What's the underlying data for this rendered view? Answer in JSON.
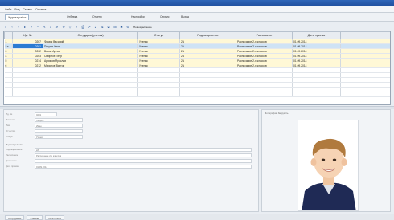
{
  "menu": {
    "items": [
      "Файл",
      "Вид",
      "Сервис",
      "Справка"
    ]
  },
  "subtabs": [
    "Журнал работ",
    "Отбивка",
    "Отчеты",
    "Настройки",
    "Сервис",
    "Выход"
  ],
  "toolbar": {
    "icons": [
      "first-icon",
      "prev-icon",
      "next-icon",
      "last-icon",
      "add-icon",
      "delete-icon",
      "edit-icon",
      "save-icon",
      "cancel-icon",
      "refresh-icon",
      "filter-icon",
      "search-icon",
      "print-icon",
      "export-icon",
      "import-icon",
      "sort-icon",
      "copy-icon",
      "paste-icon",
      "find-icon",
      "settings-icon"
    ],
    "glyphs": [
      "◂",
      "‹",
      "›",
      "▸",
      "+",
      "−",
      "✎",
      "✓",
      "✗",
      "↻",
      "▽",
      "⌕",
      "⎙",
      "↗",
      "↙",
      "⇅",
      "⧉",
      "⊞",
      "✱",
      "⚙"
    ],
    "label": "По возрастанию"
  },
  "grid": {
    "columns": [
      "",
      "Ид. №",
      "Сотрудник (ученик)",
      "Статус",
      "Подразделение",
      "Расписание",
      "Дата приема"
    ],
    "rows": [
      {
        "rn": "1",
        "id": "0207",
        "name": "Фамия Василий",
        "status": "Ученик",
        "dept": "2А",
        "schedule": "Расписание 2-х классов",
        "date": "01.09.2014",
        "selected": false
      },
      {
        "rn": "2 ▸",
        "id": "0201",
        "name": "Петров Иван",
        "status": "Ученик",
        "dept": "2А",
        "schedule": "Расписание 2-х классов",
        "date": "01.09.2014",
        "selected": true
      },
      {
        "rn": "3",
        "id": "0202",
        "name": "Васин Артем",
        "status": "Ученик",
        "dept": "2А",
        "schedule": "Расписание 2-х классов",
        "date": "01.09.2014",
        "selected": false
      },
      {
        "rn": "4",
        "id": "0203",
        "name": "Смирнов Петр",
        "status": "Ученик",
        "dept": "2А",
        "schedule": "Расписание 2-х классов",
        "date": "01.09.2014",
        "selected": false
      },
      {
        "rn": "5",
        "id": "0214",
        "name": "Архипов Ярослав",
        "status": "Ученик",
        "dept": "2А",
        "schedule": "Расписание 2-х классов",
        "date": "01.09.2014",
        "selected": false
      },
      {
        "rn": "6",
        "id": "0212",
        "name": "Миронов Виктор",
        "status": "Ученик",
        "dept": "2А",
        "schedule": "Расписание 2-х классов",
        "date": "01.09.2014",
        "selected": false
      }
    ]
  },
  "form": {
    "fields": [
      {
        "label": "Ид. №",
        "value": "0201"
      },
      {
        "label": "Фамилия",
        "value": "Петров"
      },
      {
        "label": "Имя",
        "value": "Иван"
      },
      {
        "label": "Отчество",
        "value": ""
      },
      {
        "label": "Статус",
        "value": "Ученик"
      }
    ],
    "section_title": "Подразделение",
    "fields2": [
      {
        "label": "Подразделение",
        "value": "2А"
      },
      {
        "label": "Расписание",
        "value": "Расписание 2-х классов"
      },
      {
        "label": "Должность",
        "value": ""
      },
      {
        "label": "Дата приема",
        "value": "01.09.2014"
      }
    ]
  },
  "photo": {
    "header": "Фотография   Загрузить"
  },
  "statusbar": {
    "tabs": [
      "Сотрудники",
      "Ученики",
      "Посетители"
    ]
  }
}
